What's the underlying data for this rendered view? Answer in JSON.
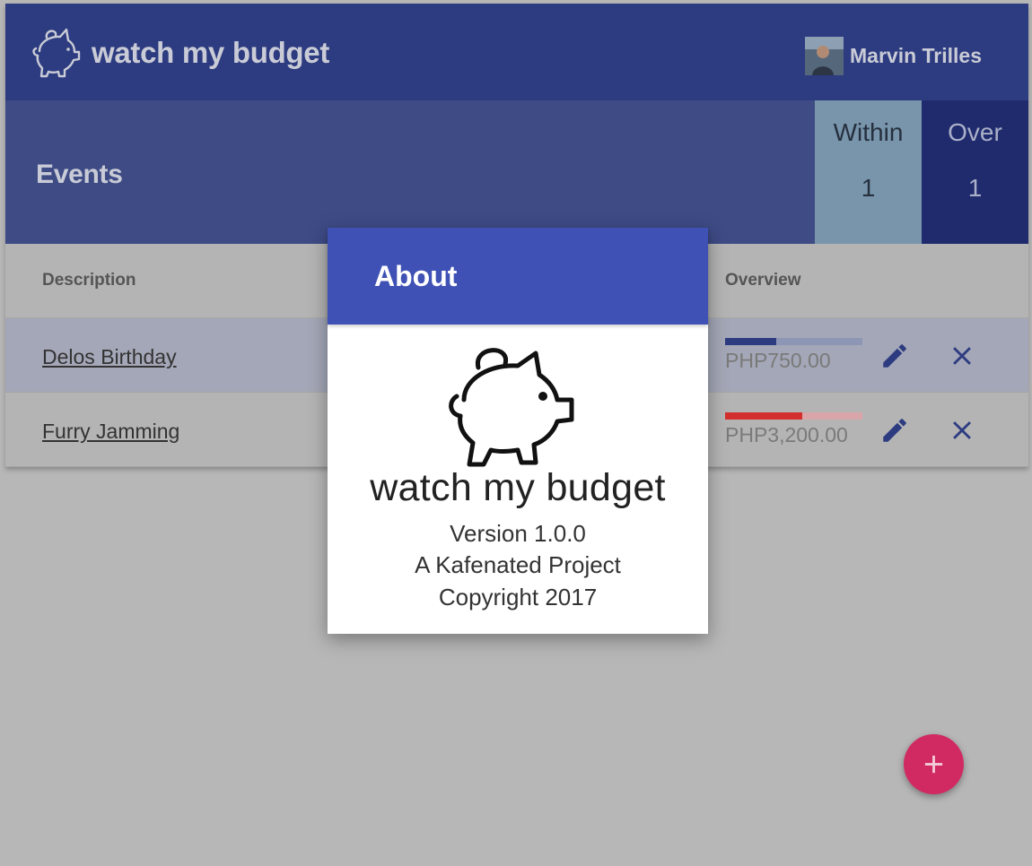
{
  "app": {
    "title": "watch my budget",
    "logo_icon": "piggy-bank-icon"
  },
  "user": {
    "name": "Marvin Trilles"
  },
  "events": {
    "title": "Events",
    "stats": [
      {
        "label": "Within",
        "count": "1"
      },
      {
        "label": "Over",
        "count": "1"
      }
    ]
  },
  "table": {
    "columns": [
      "Description",
      "Overview"
    ],
    "rows": [
      {
        "description": "Delos Birthday",
        "amount": "PHP750.00",
        "progress": 0.37,
        "status": "within"
      },
      {
        "description": "Furry Jamming",
        "amount": "PHP3,200.00",
        "progress": 0.56,
        "status": "over"
      }
    ]
  },
  "about": {
    "title": "About",
    "app_name": "watch my budget",
    "version": "Version 1.0.0",
    "project": "A Kafenated Project",
    "copyright": "Copyright 2017"
  },
  "colors": {
    "primary": "#3f51b5",
    "appbar": "#2d3b80",
    "within": "#7895ab",
    "over": "#202b6e",
    "fab": "#d12a63",
    "bar_within": "#2d3b80",
    "bar_over": "#d32f2f"
  },
  "icons": {
    "edit": "pencil-icon",
    "delete": "close-icon",
    "add": "plus-icon"
  }
}
